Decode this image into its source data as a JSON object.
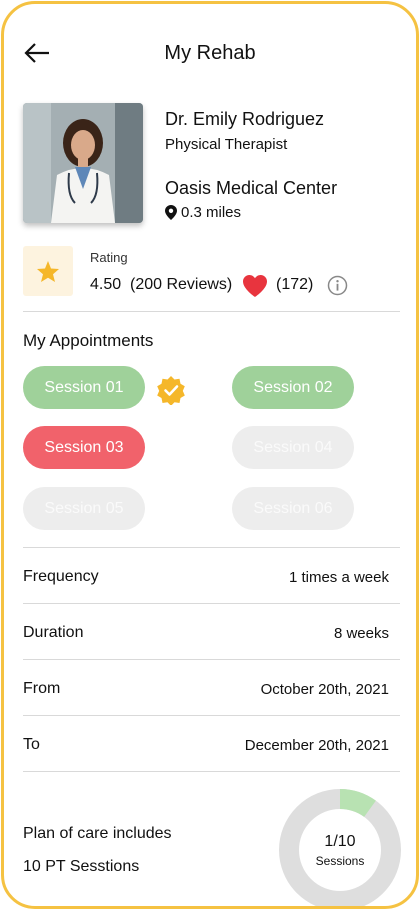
{
  "header": {
    "title": "My Rehab",
    "back_icon": "arrow-left-icon"
  },
  "doctor": {
    "name": "Dr. Emily Rodriguez",
    "role": "Physical Therapist",
    "clinic": "Oasis Medical Center",
    "distance": "0.3 miles",
    "location_icon": "map-pin-icon"
  },
  "rating": {
    "label": "Rating",
    "value": "4.50",
    "reviews": "(200 Reviews)",
    "likes": "(172)",
    "star_icon": "star-icon",
    "heart_icon": "heart-icon",
    "info_icon": "info-icon"
  },
  "appointments": {
    "title": "My Appointments",
    "sessions": [
      {
        "label": "Session 01",
        "status": "completed"
      },
      {
        "label": "Session 02",
        "status": "completed"
      },
      {
        "label": "Session 03",
        "status": "current"
      },
      {
        "label": "Session 04",
        "status": "upcoming"
      },
      {
        "label": "Session 05",
        "status": "upcoming"
      },
      {
        "label": "Session 06",
        "status": "upcoming"
      }
    ]
  },
  "details": [
    {
      "label": "Frequency",
      "value": "1 times a week"
    },
    {
      "label": "Duration",
      "value": "8 weeks"
    },
    {
      "label": "From",
      "value": "October 20th, 2021"
    },
    {
      "label": "To",
      "value": "December 20th, 2021"
    }
  ],
  "plan": {
    "label": "Plan of care includes",
    "count": "10 PT Sesstions",
    "progress_text": "1/10",
    "progress_caption": "Sessions",
    "progress_fraction": 0.1
  },
  "colors": {
    "accent_border": "#F5C242",
    "completed": "#9FD19A",
    "current": "#F1626B",
    "upcoming": "#EDEDED",
    "heart": "#E8343E",
    "star": "#F5B72A"
  }
}
